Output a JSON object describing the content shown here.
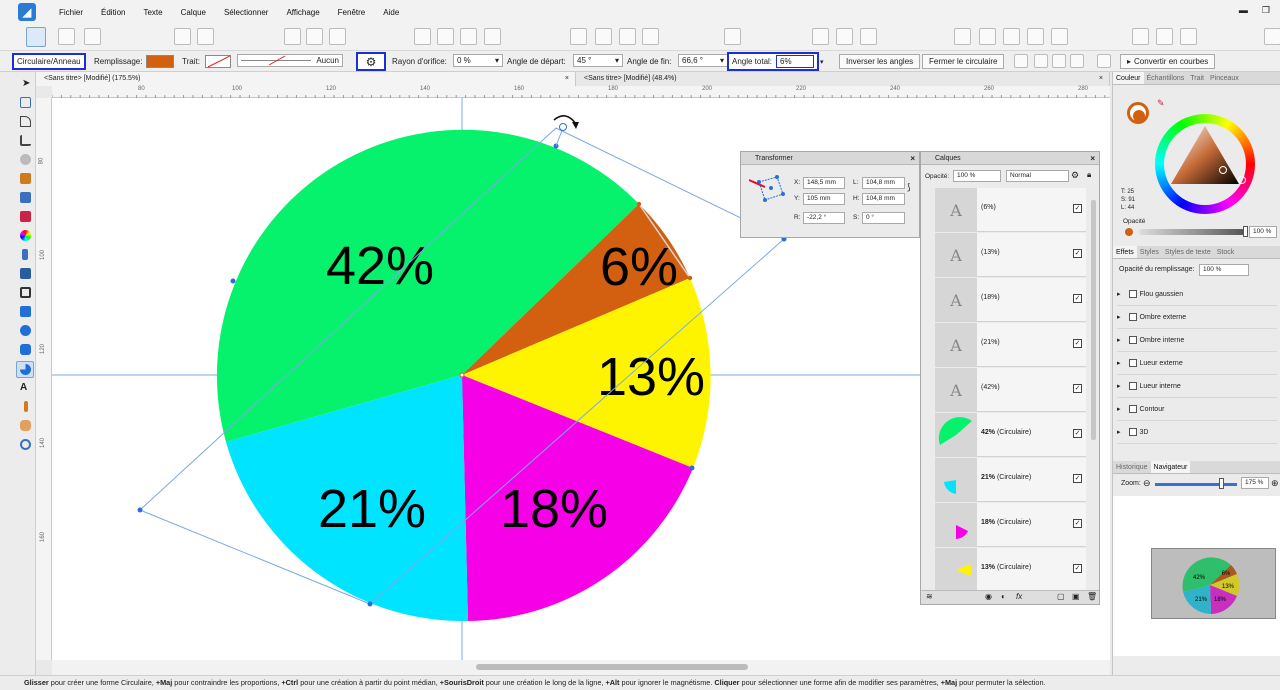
{
  "menubar": {
    "items": [
      "Fichier",
      "Édition",
      "Texte",
      "Calque",
      "Sélectionner",
      "Affichage",
      "Fenêtre",
      "Aide"
    ]
  },
  "context_toolbar": {
    "shape_label": "Circulaire/Anneau",
    "fill_label": "Remplissage:",
    "fill_color": "#d35f10",
    "stroke_label": "Trait:",
    "stroke_value": "Aucun",
    "hole_radius_label": "Rayon d'orifice:",
    "hole_radius_value": "0 %",
    "start_angle_label": "Angle de départ:",
    "start_angle_value": "45 °",
    "end_angle_label": "Angle de fin:",
    "end_angle_value": "66,6 °",
    "total_angle_label": "Angle total:",
    "total_angle_value": "6%",
    "invert_button": "Inverser les angles",
    "close_button": "Fermer le circulaire",
    "convert_button": "Convertir en courbes"
  },
  "doc_tabs": [
    "<Sans titre> [Modifié] (175.5%)",
    "<Sans titre> [Modifié] (48.4%)"
  ],
  "ruler": {
    "h_ticks": [
      "80",
      "100",
      "120",
      "140",
      "160",
      "180",
      "200",
      "220",
      "240",
      "260",
      "280"
    ],
    "v_ticks": [
      "80",
      "100",
      "120",
      "140",
      "160"
    ]
  },
  "pie": {
    "slices": [
      {
        "label": "42%",
        "color": "#06f26c"
      },
      {
        "label": "6%",
        "color": "#d35f10"
      },
      {
        "label": "13%",
        "color": "#fff400"
      },
      {
        "label": "18%",
        "color": "#f600e8"
      },
      {
        "label": "21%",
        "color": "#00e4ff"
      }
    ]
  },
  "transform_panel": {
    "title": "Transformer",
    "x_label": "X:",
    "x_value": "148,5 mm",
    "y_label": "Y:",
    "y_value": "105 mm",
    "l_label": "L:",
    "l_value": "104,8 mm",
    "h_label": "H:",
    "h_value": "104,8 mm",
    "r_label": "R:",
    "r_value": "-22,2 °",
    "s_label": "S:",
    "s_value": "0 °"
  },
  "layers_panel": {
    "title": "Calques",
    "opacity_label": "Opacité:",
    "opacity_value": "100 %",
    "blend_value": "Normal",
    "rows": [
      {
        "type": "text",
        "name": "(6%)"
      },
      {
        "type": "text",
        "name": "(13%)"
      },
      {
        "type": "text",
        "name": "(18%)"
      },
      {
        "type": "text",
        "name": "(21%)"
      },
      {
        "type": "text",
        "name": "(42%)"
      },
      {
        "type": "shape",
        "name_bold": "42%",
        "name_suffix": " (Circulaire)",
        "color": "#06f26c"
      },
      {
        "type": "shape",
        "name_bold": "21%",
        "name_suffix": " (Circulaire)",
        "color": "#00e4ff"
      },
      {
        "type": "shape",
        "name_bold": "18%",
        "name_suffix": " (Circulaire)",
        "color": "#f600e8"
      },
      {
        "type": "shape",
        "name_bold": "13%",
        "name_suffix": " (Circulaire)",
        "color": "#fff400"
      }
    ],
    "text_glyph": "A"
  },
  "right_panel": {
    "color_tabs": [
      "Couleur",
      "Échantillons",
      "Trait",
      "Pinceaux"
    ],
    "hsl": {
      "t": "T: 25",
      "s": "S: 91",
      "l": "L: 44"
    },
    "opacity_label": "Opacité",
    "opacity_value": "100 %",
    "effects_tabs": [
      "Effets",
      "Styles",
      "Styles de texte",
      "Stock"
    ],
    "fill_opacity_label": "Opacité du remplissage:",
    "fill_opacity_value": "100 %",
    "effects": [
      "Flou gaussien",
      "Ombre externe",
      "Ombre interne",
      "Lueur externe",
      "Lueur interne",
      "Contour",
      "3D"
    ],
    "nav_tabs": [
      "Historique",
      "Navigateur"
    ],
    "zoom_label": "Zoom:",
    "zoom_value": "175 %"
  },
  "status": {
    "b1": "Glisser",
    "t1": " pour créer une forme Circulaire, ",
    "b2": "+Maj",
    "t2": " pour contraindre les proportions, ",
    "b3": "+Ctrl",
    "t3": " pour une création à partir du point médian, ",
    "b4": "+SourisDroit",
    "t4": " pour une création le long de la ligne, ",
    "b5": "+Alt",
    "t5": " pour ignorer le magnétisme. ",
    "b6": "Cliquer",
    "t6": " pour sélectionner une forme afin de modifier ses paramètres, ",
    "b7": "+Maj",
    "t7": " pour permuter la sélection."
  }
}
